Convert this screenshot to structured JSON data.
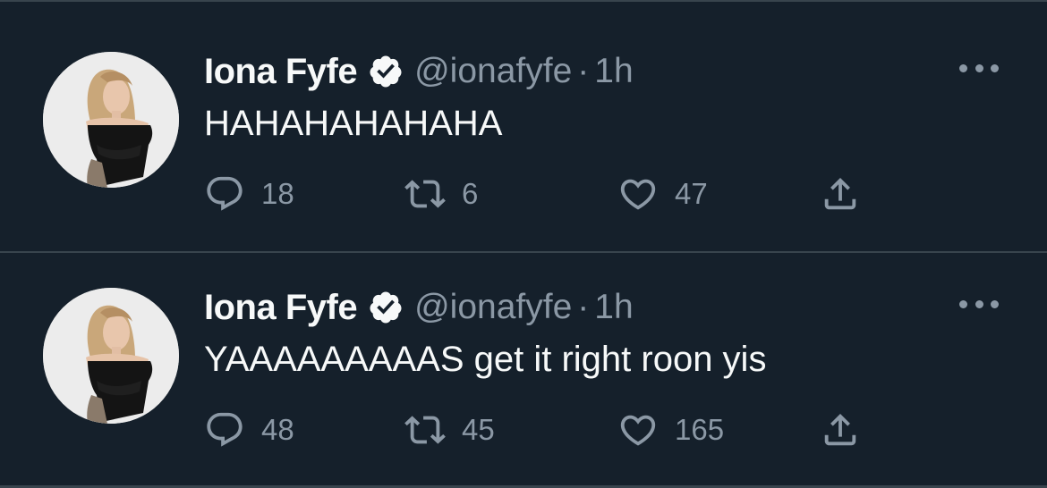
{
  "colors": {
    "background": "#15202b",
    "border": "#38444d",
    "text_primary": "#f7f9f9",
    "text_secondary": "#8b98a5"
  },
  "tweets": [
    {
      "author_name": "Iona Fyfe",
      "handle": "@ionafyfe",
      "separator": "·",
      "time": "1h",
      "verified_icon": "verified-badge-icon",
      "text": "HAHAHAHAHAHA",
      "reply_count": "18",
      "retweet_count": "6",
      "like_count": "47"
    },
    {
      "author_name": "Iona Fyfe",
      "handle": "@ionafyfe",
      "separator": "·",
      "time": "1h",
      "verified_icon": "verified-badge-icon",
      "text": "YAAAAAAAAAS get it right roon yis",
      "reply_count": "48",
      "retweet_count": "45",
      "like_count": "165"
    }
  ]
}
